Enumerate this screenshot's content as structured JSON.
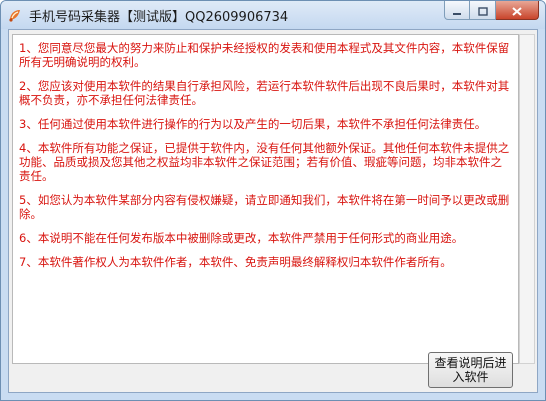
{
  "window": {
    "title": "手机号码采集器【测试版】QQ2609906734",
    "icon": "app-logo-icon",
    "controls": [
      "minimize-icon",
      "maximize-icon",
      "close-icon"
    ]
  },
  "notice": {
    "color": "#d8140f",
    "paragraphs": [
      "1、您同意尽您最大的努力来防止和保护未经授权的发表和使用本程式及其文件内容，本软件保留所有无明确说明的权利。",
      "2、您应该对使用本软件的结果自行承担风险，若运行本软件软件后出现不良后果时，本软件对其概不负责，亦不承担任何法律责任。",
      "3、任何通过使用本软件进行操作的行为以及产生的一切后果，本软件不承担任何法律责任。",
      "4、本软件所有功能之保证，已提供于软件内，没有任何其他额外保证。其他任何本软件未提供之功能、品质或损及您其他之权益均非本软件之保证范围；若有价值、瑕疵等问题，均非本软件之责任。",
      "5、如您认为本软件某部分内容有侵权嫌疑，请立即通知我们，本软件将在第一时间予以更改或删除。",
      "6、本说明不能在任何发布版本中被删除或更改，本软件严禁用于任何形式的商业用途。",
      "7、本软件著作权人为本软件作者，本软件、免责声明最终解释权归本软件作者所有。"
    ]
  },
  "enter_button": {
    "line1": "查看说明后进",
    "line2": "入软件"
  }
}
